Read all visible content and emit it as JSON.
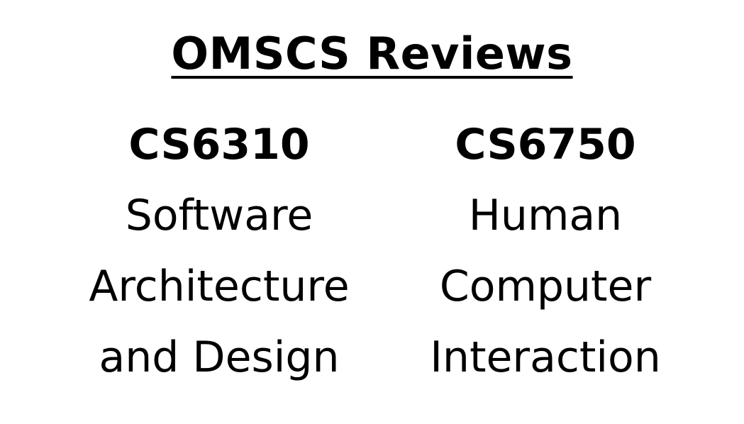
{
  "title": "OMSCS Reviews",
  "courses": [
    {
      "code": "CS6310",
      "name_lines": [
        "Software",
        "Architecture",
        "and Design"
      ]
    },
    {
      "code": "CS6750",
      "name_lines": [
        "Human",
        "Computer",
        "Interaction"
      ]
    }
  ]
}
